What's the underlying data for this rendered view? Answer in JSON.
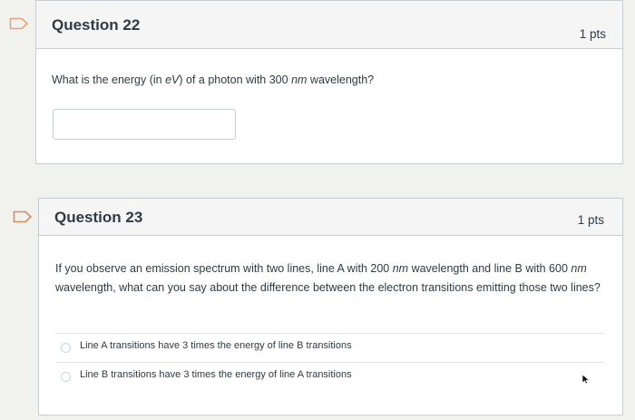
{
  "questions": [
    {
      "title": "Question 22",
      "points": "1 pts",
      "text": {
        "part1": "What is the energy (in ",
        "unit1": "eV",
        "part2": ") of a photon with 300 ",
        "unit2": "nm",
        "part3": " wavelength?"
      },
      "answer_value": ""
    },
    {
      "title": "Question 23",
      "points": "1 pts",
      "text": {
        "part1": "If you observe an emission spectrum with two lines, line A with 200 ",
        "unit1": "nm",
        "part2": " wavelength and line B with 600 ",
        "unit2": "nm",
        "part3": " wavelength, what can you say about the difference between the electron transitions emitting those two lines?"
      },
      "options": [
        "Line A transitions have 3 times the energy of line B transitions",
        "Line B transitions have 3 times the energy of line A transitions"
      ]
    }
  ],
  "colors": {
    "flag_stroke": "#e9a27f",
    "flag_stroke_dark": "#d68a68",
    "radio_border": "#c0d8e6",
    "header_bg": "#f5f5f5",
    "border": "#c7cdd1"
  },
  "icons": {
    "flag": "bookmark-flag-icon",
    "cursor": "mouse-cursor-icon"
  }
}
